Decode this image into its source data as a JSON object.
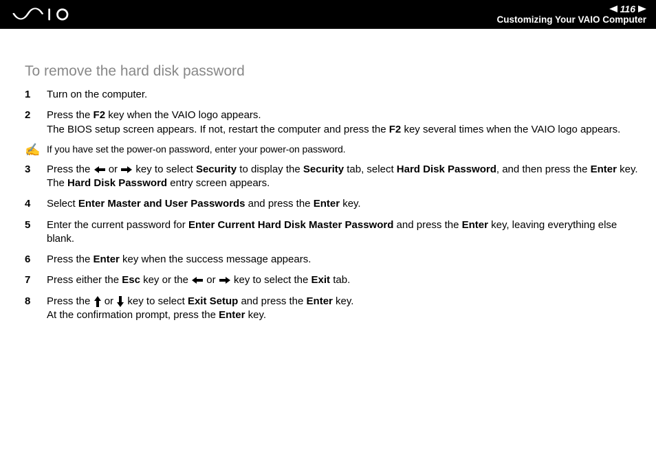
{
  "header": {
    "page_number": "116",
    "section": "Customizing Your VAIO Computer"
  },
  "title": "To remove the hard disk password",
  "note": {
    "text": "If you have set the power-on password, enter your power-on password."
  },
  "steps": {
    "s1": {
      "num": "1",
      "a": "Turn on the computer."
    },
    "s2": {
      "num": "2",
      "a": "Press the ",
      "b": "F2",
      "c": " key when the VAIO logo appears.",
      "d": "The BIOS setup screen appears. If not, restart the computer and press the ",
      "e": "F2",
      "f": " key several times when the VAIO logo appears."
    },
    "s3": {
      "num": "3",
      "a": "Press the ",
      "b": " or ",
      "c": " key to select ",
      "d": "Security",
      "e": " to display the ",
      "f": "Security",
      "g": " tab, select ",
      "h": "Hard Disk Password",
      "i": ", and then press the ",
      "j": "Enter",
      "k": " key.",
      "l": "The ",
      "m": "Hard Disk Password",
      "n": " entry screen appears."
    },
    "s4": {
      "num": "4",
      "a": "Select ",
      "b": "Enter Master and User Passwords",
      "c": " and press the ",
      "d": "Enter",
      "e": " key."
    },
    "s5": {
      "num": "5",
      "a": "Enter the current password for ",
      "b": "Enter Current Hard Disk Master Password",
      "c": " and press the ",
      "d": "Enter",
      "e": " key, leaving everything else blank."
    },
    "s6": {
      "num": "6",
      "a": "Press the ",
      "b": "Enter",
      "c": " key when the success message appears."
    },
    "s7": {
      "num": "7",
      "a": "Press either the ",
      "b": "Esc",
      "c": " key or the ",
      "d": " or ",
      "e": " key to select the ",
      "f": "Exit",
      "g": " tab."
    },
    "s8": {
      "num": "8",
      "a": "Press the ",
      "b": " or ",
      "c": " key to select ",
      "d": "Exit Setup",
      "e": " and press the ",
      "f": "Enter",
      "g": " key.",
      "h": "At the confirmation prompt, press the ",
      "i": "Enter",
      "j": " key."
    }
  }
}
